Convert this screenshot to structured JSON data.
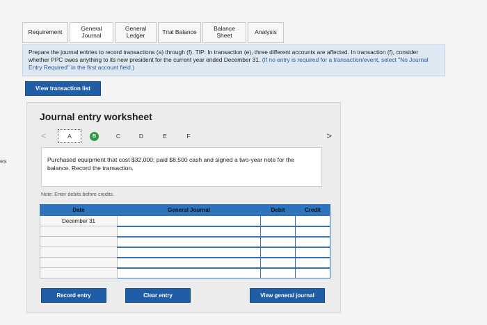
{
  "edge_text": "es",
  "tabs": [
    {
      "label": "Requirement"
    },
    {
      "label": "General Journal"
    },
    {
      "label": "General Ledger"
    },
    {
      "label": "Trial Balance"
    },
    {
      "label": "Balance Sheet"
    },
    {
      "label": "Analysis"
    }
  ],
  "instructions": {
    "text_main": "Prepare the journal entries to record transactions (a) through (f). TIP: In transaction (e), three different accounts are affected. In transaction (f), consider whether PPC owes anything to its new president for the current year ended December 31.",
    "text_ref": "(If no entry is required for a transaction/event, select \"No Journal Entry Required\" in the first account field.)"
  },
  "view_transaction_list_label": "View transaction list",
  "worksheet": {
    "title": "Journal entry worksheet",
    "pager": {
      "left_arrow": "<",
      "right_arrow": ">",
      "items": [
        "A",
        "B",
        "C",
        "D",
        "E",
        "F"
      ]
    },
    "description": "Purchased equipment that cost $32,000; paid $8,500 cash and signed a two-year note for the balance. Record the transaction.",
    "note": "Note: Enter debits before credits.",
    "table": {
      "headers": {
        "date": "Date",
        "journal": "General Journal",
        "debit": "Debit",
        "credit": "Credit"
      },
      "first_date": "December 31"
    },
    "buttons": {
      "record": "Record entry",
      "clear": "Clear entry",
      "view_journal": "View general journal"
    }
  },
  "colors": {
    "accent_blue": "#1f5da6",
    "header_blue": "#2e74bc",
    "instructions_bg": "#dde8f3",
    "completed_green": "#2f9a46"
  }
}
